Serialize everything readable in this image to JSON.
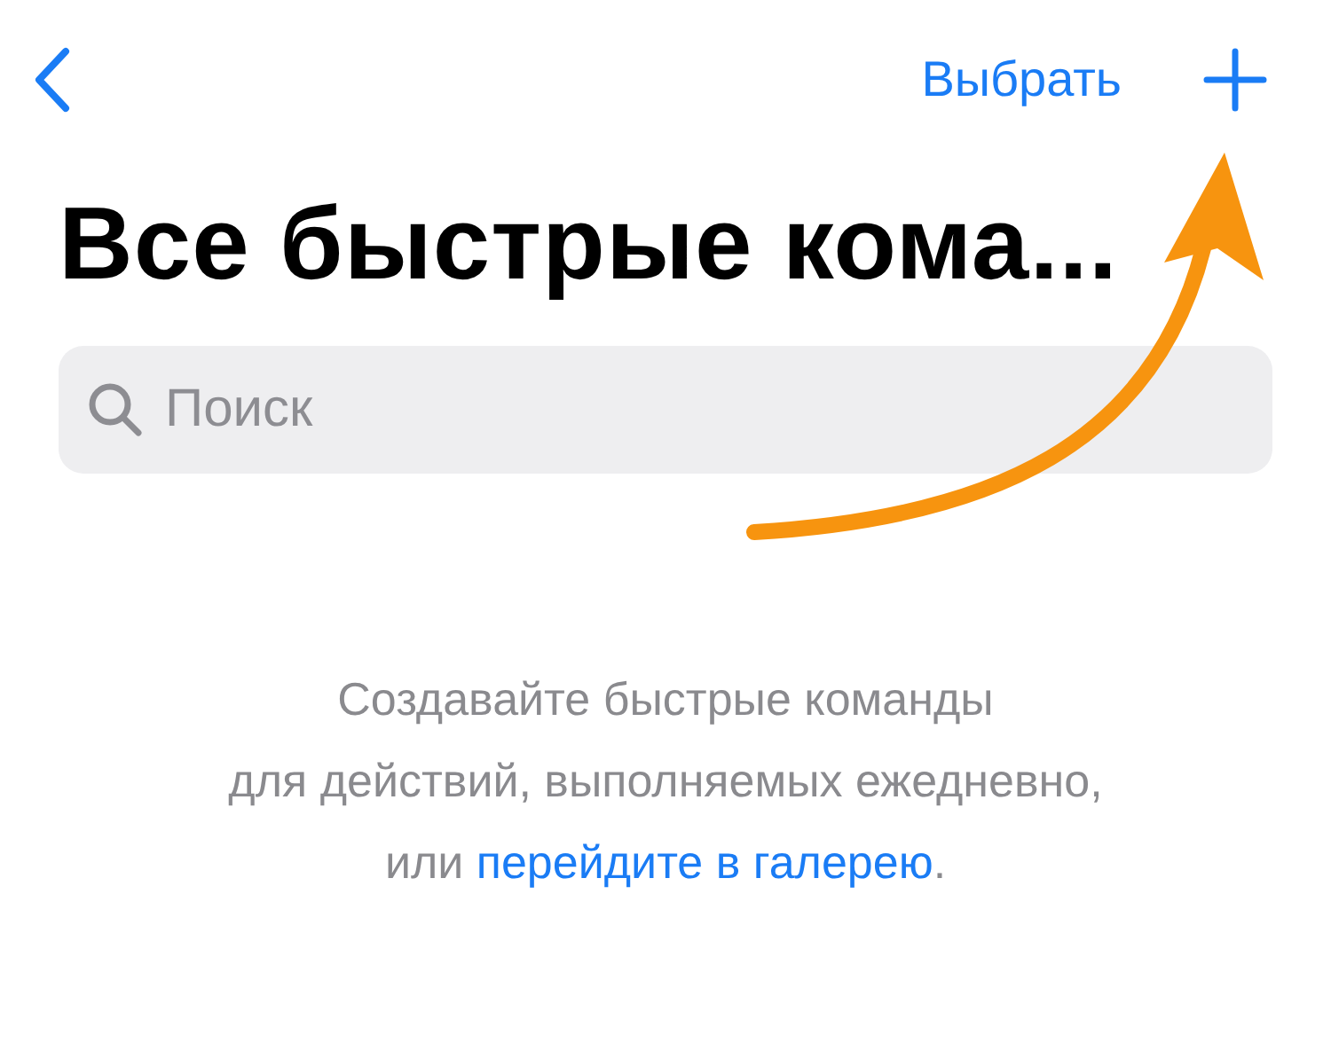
{
  "nav": {
    "select_label": "Выбрать"
  },
  "title": "Все быстрые кома...",
  "search": {
    "placeholder": "Поиск"
  },
  "empty_state": {
    "lines": [
      "Создавайте быстрые команды",
      "для действий, выполняемых ежедневно,"
    ],
    "last_line_prefix": "или ",
    "link": "перейдите в галерею",
    "last_line_suffix": "."
  }
}
